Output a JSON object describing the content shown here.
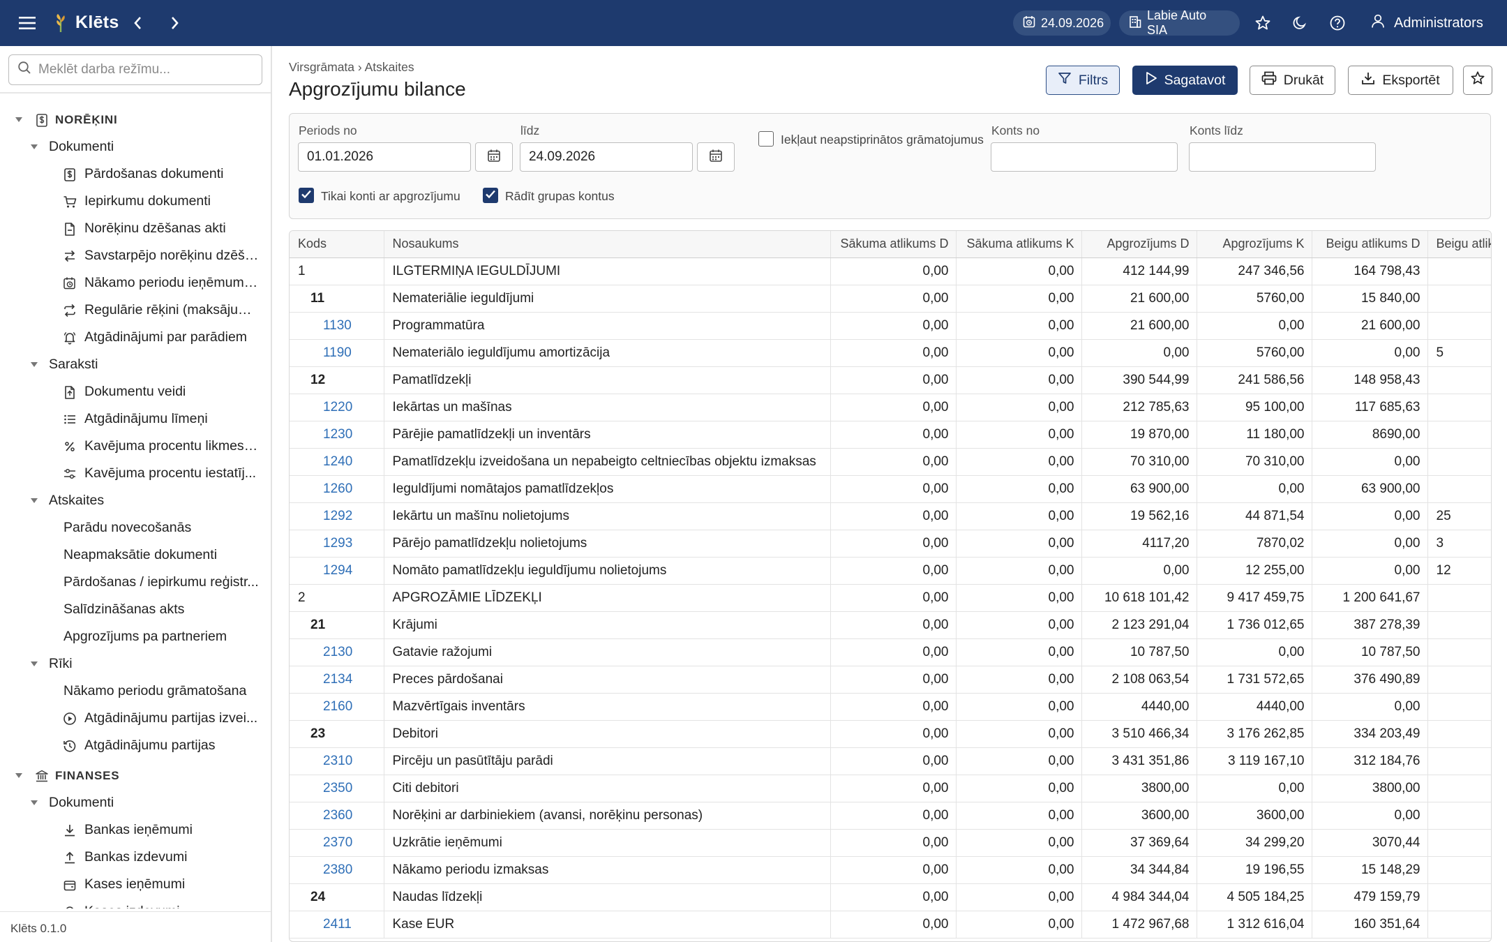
{
  "app": {
    "title": "Klēts",
    "date": "24.09.2026",
    "company": "Labie Auto SIA",
    "user": "Administrators",
    "version": "Klēts 0.1.0",
    "accent": "#1e3a6e",
    "link_color": "#2f6fb7"
  },
  "sidebar": {
    "search_placeholder": "Meklēt darba režīmu...",
    "tree": [
      {
        "level": "section",
        "icon": "dollar-doc-icon",
        "label": "NORĒĶINI"
      },
      {
        "level": "group",
        "label": "Dokumenti"
      },
      {
        "level": "item",
        "icon": "invoice-icon",
        "label": "Pārdošanas dokumenti"
      },
      {
        "level": "item",
        "icon": "cart-icon",
        "label": "Iepirkumu dokumenti"
      },
      {
        "level": "item",
        "icon": "doc-minus-icon",
        "label": "Norēķinu dzēšanas akti"
      },
      {
        "level": "item",
        "icon": "swap-icon",
        "label": "Savstarpējo norēķinu dzēša..."
      },
      {
        "level": "item",
        "icon": "calendar-clock-icon",
        "label": "Nākamo periodu ieņēmumi ..."
      },
      {
        "level": "item",
        "icon": "repeat-icon",
        "label": "Regulārie rēķini (maksājum..."
      },
      {
        "level": "item",
        "icon": "bell-icon",
        "label": "Atgādinājumi par parādiem"
      },
      {
        "level": "group",
        "label": "Saraksti"
      },
      {
        "level": "item",
        "icon": "doc-type-icon",
        "label": "Dokumentu veidi"
      },
      {
        "level": "item",
        "icon": "list-icon",
        "label": "Atgādinājumu līmeņi"
      },
      {
        "level": "item",
        "icon": "percent-icon",
        "label": "Kavējuma procentu likmes (..."
      },
      {
        "level": "item",
        "icon": "settings-sliders-icon",
        "label": "Kavējuma procentu iestatīj..."
      },
      {
        "level": "group",
        "label": "Atskaites"
      },
      {
        "level": "item",
        "icon": "",
        "label": "Parādu novecošanās"
      },
      {
        "level": "item",
        "icon": "",
        "label": "Neapmaksātie dokumenti"
      },
      {
        "level": "item",
        "icon": "",
        "label": "Pārdošanas / iepirkumu reģistr..."
      },
      {
        "level": "item",
        "icon": "",
        "label": "Salīdzināšanas akts"
      },
      {
        "level": "item",
        "icon": "",
        "label": "Apgrozījums pa partneriem"
      },
      {
        "level": "group",
        "label": "Rīki"
      },
      {
        "level": "item",
        "icon": "",
        "label": "Nākamo periodu grāmatošana"
      },
      {
        "level": "item",
        "icon": "play-circle-icon",
        "label": "Atgādinājumu partijas izvei..."
      },
      {
        "level": "item",
        "icon": "history-icon",
        "label": "Atgādinājumu partijas"
      },
      {
        "level": "section",
        "icon": "bank-icon",
        "label": "FINANSES"
      },
      {
        "level": "group",
        "label": "Dokumenti"
      },
      {
        "level": "item",
        "icon": "download-icon",
        "label": "Bankas ieņēmumi"
      },
      {
        "level": "item",
        "icon": "upload-icon",
        "label": "Bankas izdevumi"
      },
      {
        "level": "item",
        "icon": "cash-register-icon",
        "label": "Kases ieņēmumi"
      },
      {
        "level": "item",
        "icon": "cash-out-icon",
        "label": "Kases izdevumi"
      }
    ]
  },
  "main": {
    "breadcrumb": "Virsgrāmata › Atskaites",
    "title": "Apgrozījumu bilance",
    "buttons": {
      "filter": "Filtrs",
      "generate": "Sagatavot",
      "print": "Drukāt",
      "export": "Eksportēt"
    },
    "filter": {
      "period_from_label": "Periods no",
      "period_from": "01.01.2026",
      "period_to_label": "līdz",
      "period_to": "24.09.2026",
      "include_unapproved_label": "Iekļaut neapstiprinātos grāmatojumus",
      "include_unapproved": false,
      "account_from_label": "Konts no",
      "account_from": "",
      "account_to_label": "Konts līdz",
      "account_to": "",
      "only_with_turnover_label": "Tikai konti ar apgrozījumu",
      "only_with_turnover": true,
      "show_group_accounts_label": "Rādīt grupas kontus",
      "show_group_accounts": true
    },
    "table": {
      "columns": [
        "Kods",
        "Nosaukums",
        "Sākuma atlikums D",
        "Sākuma atlikums K",
        "Apgrozījums D",
        "Apgrozījums K",
        "Beigu atlikums D",
        "Beigu atlikums K"
      ],
      "rows": [
        {
          "type": "g1",
          "code": "1",
          "name": "ILGTERMIŅA IEGULDĪJUMI",
          "sd": "0,00",
          "sk": "0,00",
          "ad": "412 144,99",
          "ak": "247 346,56",
          "bd": "164 798,43",
          "bk": ""
        },
        {
          "type": "g2",
          "code": "11",
          "name": "Nemateriālie ieguldījumi",
          "sd": "0,00",
          "sk": "0,00",
          "ad": "21 600,00",
          "ak": "5760,00",
          "bd": "15 840,00",
          "bk": ""
        },
        {
          "type": "acc",
          "code": "1130",
          "name": "Programmatūra",
          "sd": "0,00",
          "sk": "0,00",
          "ad": "21 600,00",
          "ak": "0,00",
          "bd": "21 600,00",
          "bk": ""
        },
        {
          "type": "acc",
          "code": "1190",
          "name": "Nemateriālo ieguldījumu amortizācija",
          "sd": "0,00",
          "sk": "0,00",
          "ad": "0,00",
          "ak": "5760,00",
          "bd": "0,00",
          "bk": "5"
        },
        {
          "type": "g2",
          "code": "12",
          "name": "Pamatlīdzekļi",
          "sd": "0,00",
          "sk": "0,00",
          "ad": "390 544,99",
          "ak": "241 586,56",
          "bd": "148 958,43",
          "bk": ""
        },
        {
          "type": "acc",
          "code": "1220",
          "name": "Iekārtas un mašīnas",
          "sd": "0,00",
          "sk": "0,00",
          "ad": "212 785,63",
          "ak": "95 100,00",
          "bd": "117 685,63",
          "bk": ""
        },
        {
          "type": "acc",
          "code": "1230",
          "name": "Pārējie pamatlīdzekļi un inventārs",
          "sd": "0,00",
          "sk": "0,00",
          "ad": "19 870,00",
          "ak": "11 180,00",
          "bd": "8690,00",
          "bk": ""
        },
        {
          "type": "acc",
          "code": "1240",
          "name": "Pamatlīdzekļu izveidošana un nepabeigto celtniecības objektu izmaksas",
          "sd": "0,00",
          "sk": "0,00",
          "ad": "70 310,00",
          "ak": "70 310,00",
          "bd": "0,00",
          "bk": ""
        },
        {
          "type": "acc",
          "code": "1260",
          "name": "Ieguldījumi nomātajos pamatlīdzekļos",
          "sd": "0,00",
          "sk": "0,00",
          "ad": "63 900,00",
          "ak": "0,00",
          "bd": "63 900,00",
          "bk": ""
        },
        {
          "type": "acc",
          "code": "1292",
          "name": "Iekārtu un mašīnu nolietojums",
          "sd": "0,00",
          "sk": "0,00",
          "ad": "19 562,16",
          "ak": "44 871,54",
          "bd": "0,00",
          "bk": "25"
        },
        {
          "type": "acc",
          "code": "1293",
          "name": "Pārējo pamatlīdzekļu nolietojums",
          "sd": "0,00",
          "sk": "0,00",
          "ad": "4117,20",
          "ak": "7870,02",
          "bd": "0,00",
          "bk": "3"
        },
        {
          "type": "acc",
          "code": "1294",
          "name": "Nomāto pamatlīdzekļu ieguldījumu nolietojums",
          "sd": "0,00",
          "sk": "0,00",
          "ad": "0,00",
          "ak": "12 255,00",
          "bd": "0,00",
          "bk": "12"
        },
        {
          "type": "g1",
          "code": "2",
          "name": "APGROZĀMIE LĪDZEKĻI",
          "sd": "0,00",
          "sk": "0,00",
          "ad": "10 618 101,42",
          "ak": "9 417 459,75",
          "bd": "1 200 641,67",
          "bk": ""
        },
        {
          "type": "g2",
          "code": "21",
          "name": "Krājumi",
          "sd": "0,00",
          "sk": "0,00",
          "ad": "2 123 291,04",
          "ak": "1 736 012,65",
          "bd": "387 278,39",
          "bk": ""
        },
        {
          "type": "acc",
          "code": "2130",
          "name": "Gatavie ražojumi",
          "sd": "0,00",
          "sk": "0,00",
          "ad": "10 787,50",
          "ak": "0,00",
          "bd": "10 787,50",
          "bk": ""
        },
        {
          "type": "acc",
          "code": "2134",
          "name": "Preces pārdošanai",
          "sd": "0,00",
          "sk": "0,00",
          "ad": "2 108 063,54",
          "ak": "1 731 572,65",
          "bd": "376 490,89",
          "bk": ""
        },
        {
          "type": "acc",
          "code": "2160",
          "name": "Mazvērtīgais inventārs",
          "sd": "0,00",
          "sk": "0,00",
          "ad": "4440,00",
          "ak": "4440,00",
          "bd": "0,00",
          "bk": ""
        },
        {
          "type": "g2",
          "code": "23",
          "name": "Debitori",
          "sd": "0,00",
          "sk": "0,00",
          "ad": "3 510 466,34",
          "ak": "3 176 262,85",
          "bd": "334 203,49",
          "bk": ""
        },
        {
          "type": "acc",
          "code": "2310",
          "name": "Pircēju un pasūtītāju parādi",
          "sd": "0,00",
          "sk": "0,00",
          "ad": "3 431 351,86",
          "ak": "3 119 167,10",
          "bd": "312 184,76",
          "bk": ""
        },
        {
          "type": "acc",
          "code": "2350",
          "name": "Citi debitori",
          "sd": "0,00",
          "sk": "0,00",
          "ad": "3800,00",
          "ak": "0,00",
          "bd": "3800,00",
          "bk": ""
        },
        {
          "type": "acc",
          "code": "2360",
          "name": "Norēķini ar darbiniekiem (avansi, norēķinu personas)",
          "sd": "0,00",
          "sk": "0,00",
          "ad": "3600,00",
          "ak": "3600,00",
          "bd": "0,00",
          "bk": ""
        },
        {
          "type": "acc",
          "code": "2370",
          "name": "Uzkrātie ieņēmumi",
          "sd": "0,00",
          "sk": "0,00",
          "ad": "37 369,64",
          "ak": "34 299,20",
          "bd": "3070,44",
          "bk": ""
        },
        {
          "type": "acc",
          "code": "2380",
          "name": "Nākamo periodu izmaksas",
          "sd": "0,00",
          "sk": "0,00",
          "ad": "34 344,84",
          "ak": "19 196,55",
          "bd": "15 148,29",
          "bk": ""
        },
        {
          "type": "g2",
          "code": "24",
          "name": "Naudas līdzekļi",
          "sd": "0,00",
          "sk": "0,00",
          "ad": "4 984 344,04",
          "ak": "4 505 184,25",
          "bd": "479 159,79",
          "bk": ""
        },
        {
          "type": "acc",
          "code": "2411",
          "name": "Kase EUR",
          "sd": "0,00",
          "sk": "0,00",
          "ad": "1 472 967,68",
          "ak": "1 312 616,04",
          "bd": "160 351,64",
          "bk": ""
        }
      ]
    }
  }
}
